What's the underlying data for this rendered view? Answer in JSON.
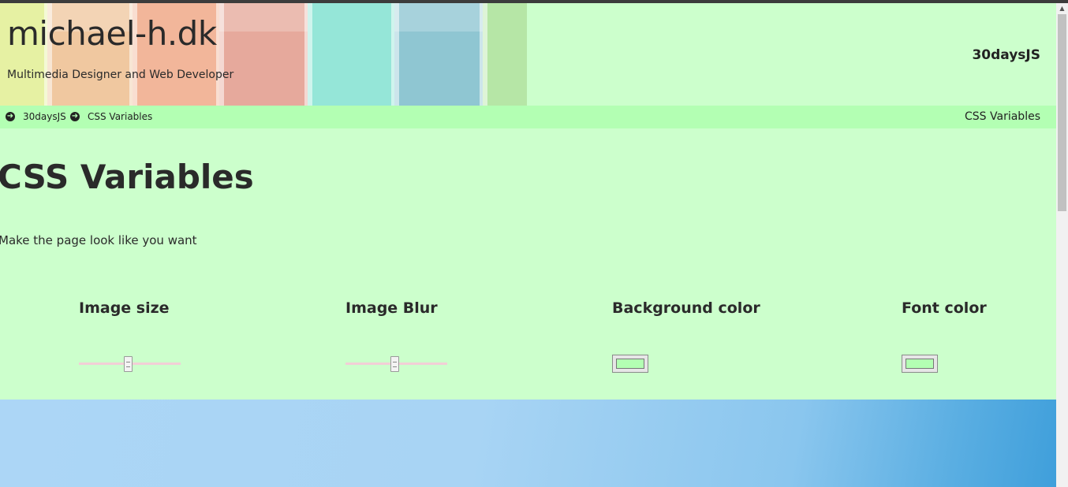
{
  "header": {
    "site_title": "michael-h.dk",
    "tagline": "Multimedia Designer and Web Developer",
    "nav_link": "30daysJS"
  },
  "breadcrumb": {
    "items": [
      {
        "label": "30daysJS",
        "icon": "arrow-circle-right-icon"
      },
      {
        "label": "CSS Variables",
        "icon": "arrow-circle-right-icon"
      }
    ],
    "current": "CSS Variables"
  },
  "main": {
    "title": "CSS Variables",
    "intro": "Make the page look like you want",
    "controls": [
      {
        "label": "Image size",
        "type": "range",
        "value_fraction": 0.48
      },
      {
        "label": "Image Blur",
        "type": "range",
        "value_fraction": 0.48
      },
      {
        "label": "Background color",
        "type": "color",
        "value": "#b3ffb3"
      },
      {
        "label": "Font color",
        "type": "color",
        "value": "#b3ffb3"
      }
    ]
  },
  "colors": {
    "page_background": "#ccffcc",
    "breadcrumb_background": "#b3ffb3",
    "text": "#222222"
  }
}
